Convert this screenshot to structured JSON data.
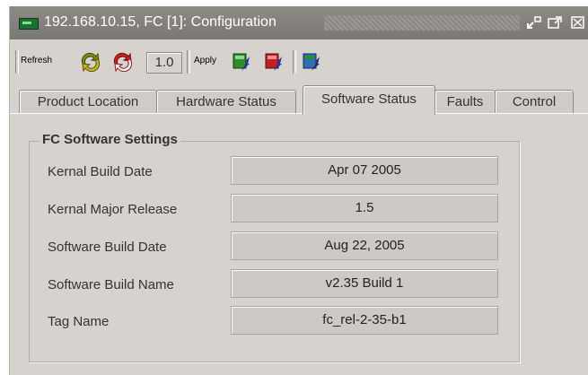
{
  "window": {
    "title": "192.168.10.15, FC  [1]: Configuration",
    "controls": [
      "restore-icon",
      "maximize-icon",
      "close-icon"
    ]
  },
  "toolbar": {
    "refresh_label": "Refresh",
    "zoom_value": "1.0",
    "apply_label": "Apply",
    "icons": [
      "refresh-green-icon",
      "refresh-red-icon",
      "apply-green-icon",
      "apply-red-icon",
      "apply-blue-icon"
    ]
  },
  "tabs": [
    {
      "label": "Product Location",
      "active": false
    },
    {
      "label": "Hardware Status",
      "active": false
    },
    {
      "label": "Software Status",
      "active": true
    },
    {
      "label": "Faults",
      "active": false
    },
    {
      "label": "Control",
      "active": false
    }
  ],
  "settings": {
    "group_title": "FC Software Settings",
    "rows": [
      {
        "label": "Kernal Build Date",
        "value": "Apr 07 2005"
      },
      {
        "label": "Kernal Major Release",
        "value": "1.5"
      },
      {
        "label": "Software Build Date",
        "value": "Aug 22, 2005"
      },
      {
        "label": "Software Build Name",
        "value": "v2.35 Build 1"
      },
      {
        "label": "Tag Name",
        "value": "fc_rel-2-35-b1"
      }
    ]
  }
}
